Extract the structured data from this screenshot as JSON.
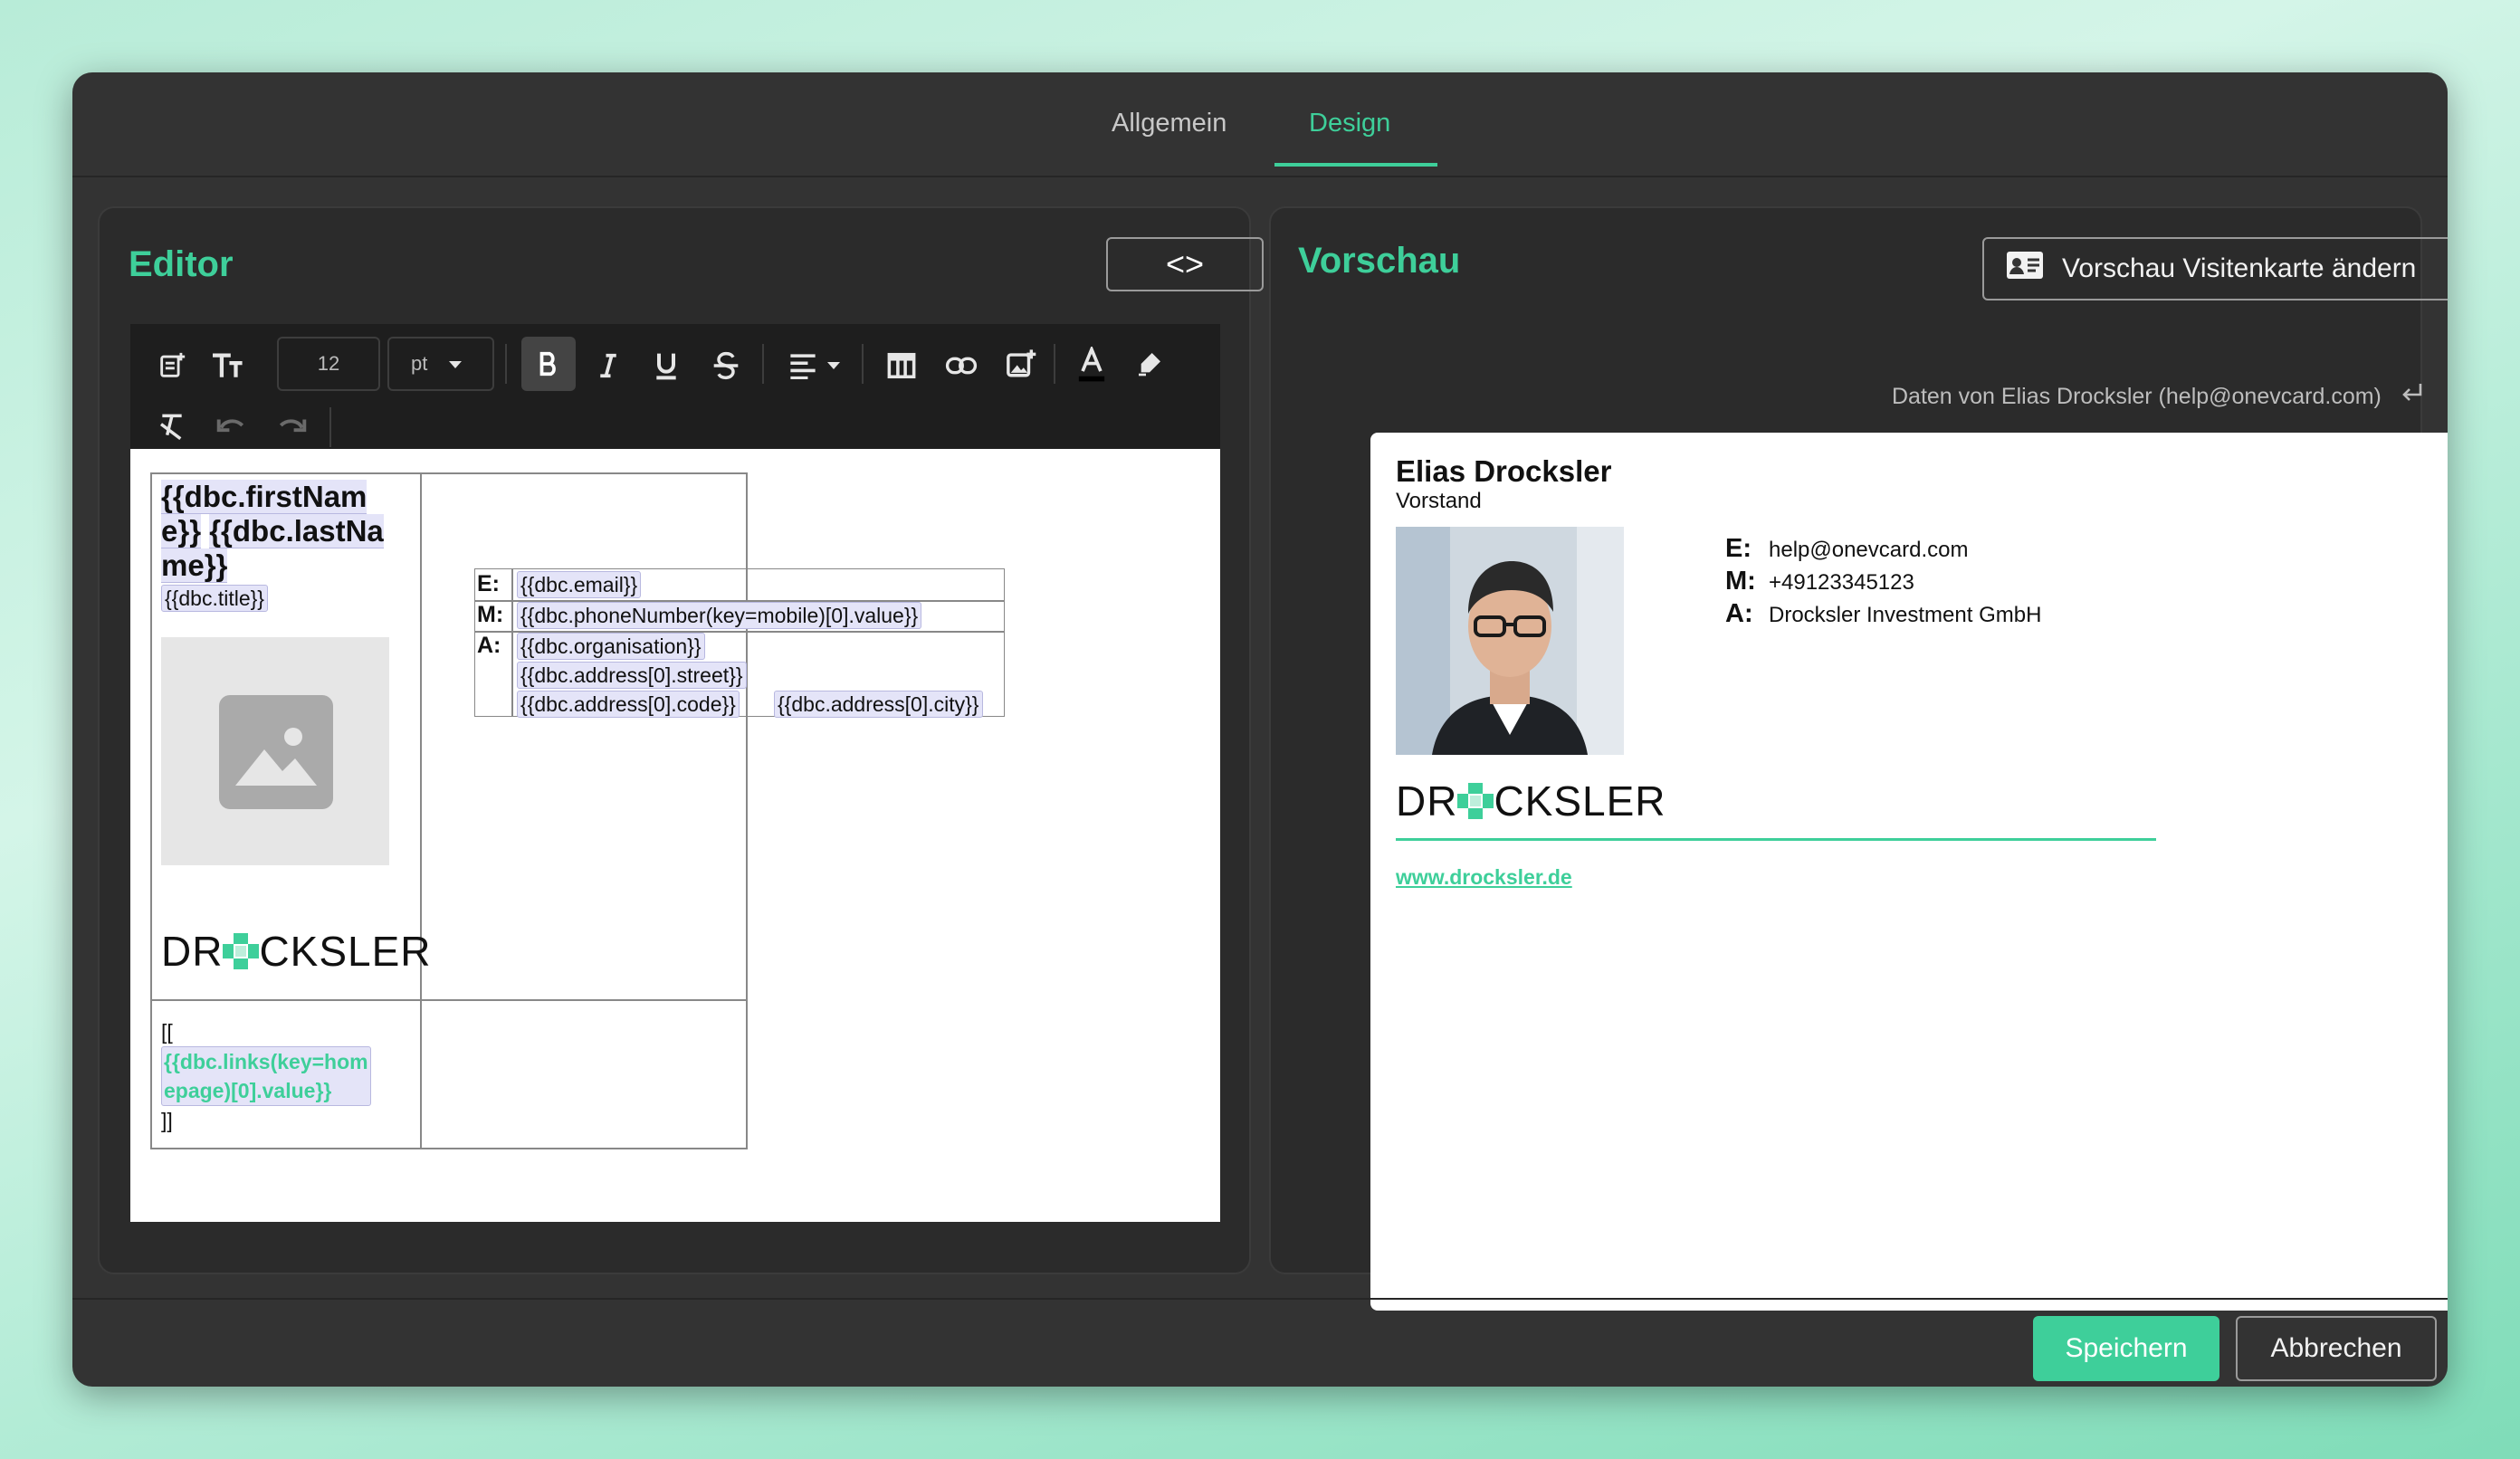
{
  "tabs": [
    {
      "label": "Allgemein",
      "active": false
    },
    {
      "label": "Design",
      "active": true
    }
  ],
  "editor": {
    "title": "Editor",
    "code_button_label": "<>",
    "toolbar": {
      "font_size_value": "12",
      "font_unit_value": "pt"
    },
    "template": {
      "first_name_part1": "{{dbc.firstNam",
      "first_name_part2": "e}}",
      "last_name_part1": "{{dbc.lastNa",
      "last_name_part2": "me}}",
      "title_ph": "{{dbc.title}}",
      "logo_text_left": "DR",
      "logo_text_right": "CKSLER",
      "link_open": "[[",
      "link_ph_line1": "{{dbc.links(key=hom",
      "link_ph_line2": "epage)[0].value}}",
      "link_close": "]]",
      "contact_rows": [
        {
          "label": "E:",
          "values": [
            "{{dbc.email}}"
          ]
        },
        {
          "label": "M:",
          "values": [
            "{{dbc.phoneNumber(key=mobile)[0].value}}"
          ]
        },
        {
          "label": "A:",
          "values": [
            "{{dbc.organisation}}",
            "{{dbc.address[0].street}}",
            "{{dbc.address[0].code}}",
            "{{dbc.address[0].city}}"
          ]
        }
      ]
    }
  },
  "preview": {
    "title": "Vorschau",
    "change_button_label": "Vorschau Visitenkarte ändern",
    "data_from": "Daten von Elias Drocksler (help@onevcard.com)",
    "card": {
      "name": "Elias Drocksler",
      "position": "Vorstand",
      "email_label": "E:",
      "email": "help@onevcard.com",
      "mobile_label": "M:",
      "mobile": "+49123345123",
      "address_label": "A:",
      "organisation": "Drocksler Investment GmbH",
      "logo_left": "DR",
      "logo_right": "CKSLER",
      "website": "www.drocksler.de"
    }
  },
  "footer": {
    "save_label": "Speichern",
    "cancel_label": "Abbrechen"
  },
  "colors": {
    "accent": "#3ecf9a",
    "dialog_bg": "#333333",
    "panel_bg": "#2b2b2b"
  }
}
